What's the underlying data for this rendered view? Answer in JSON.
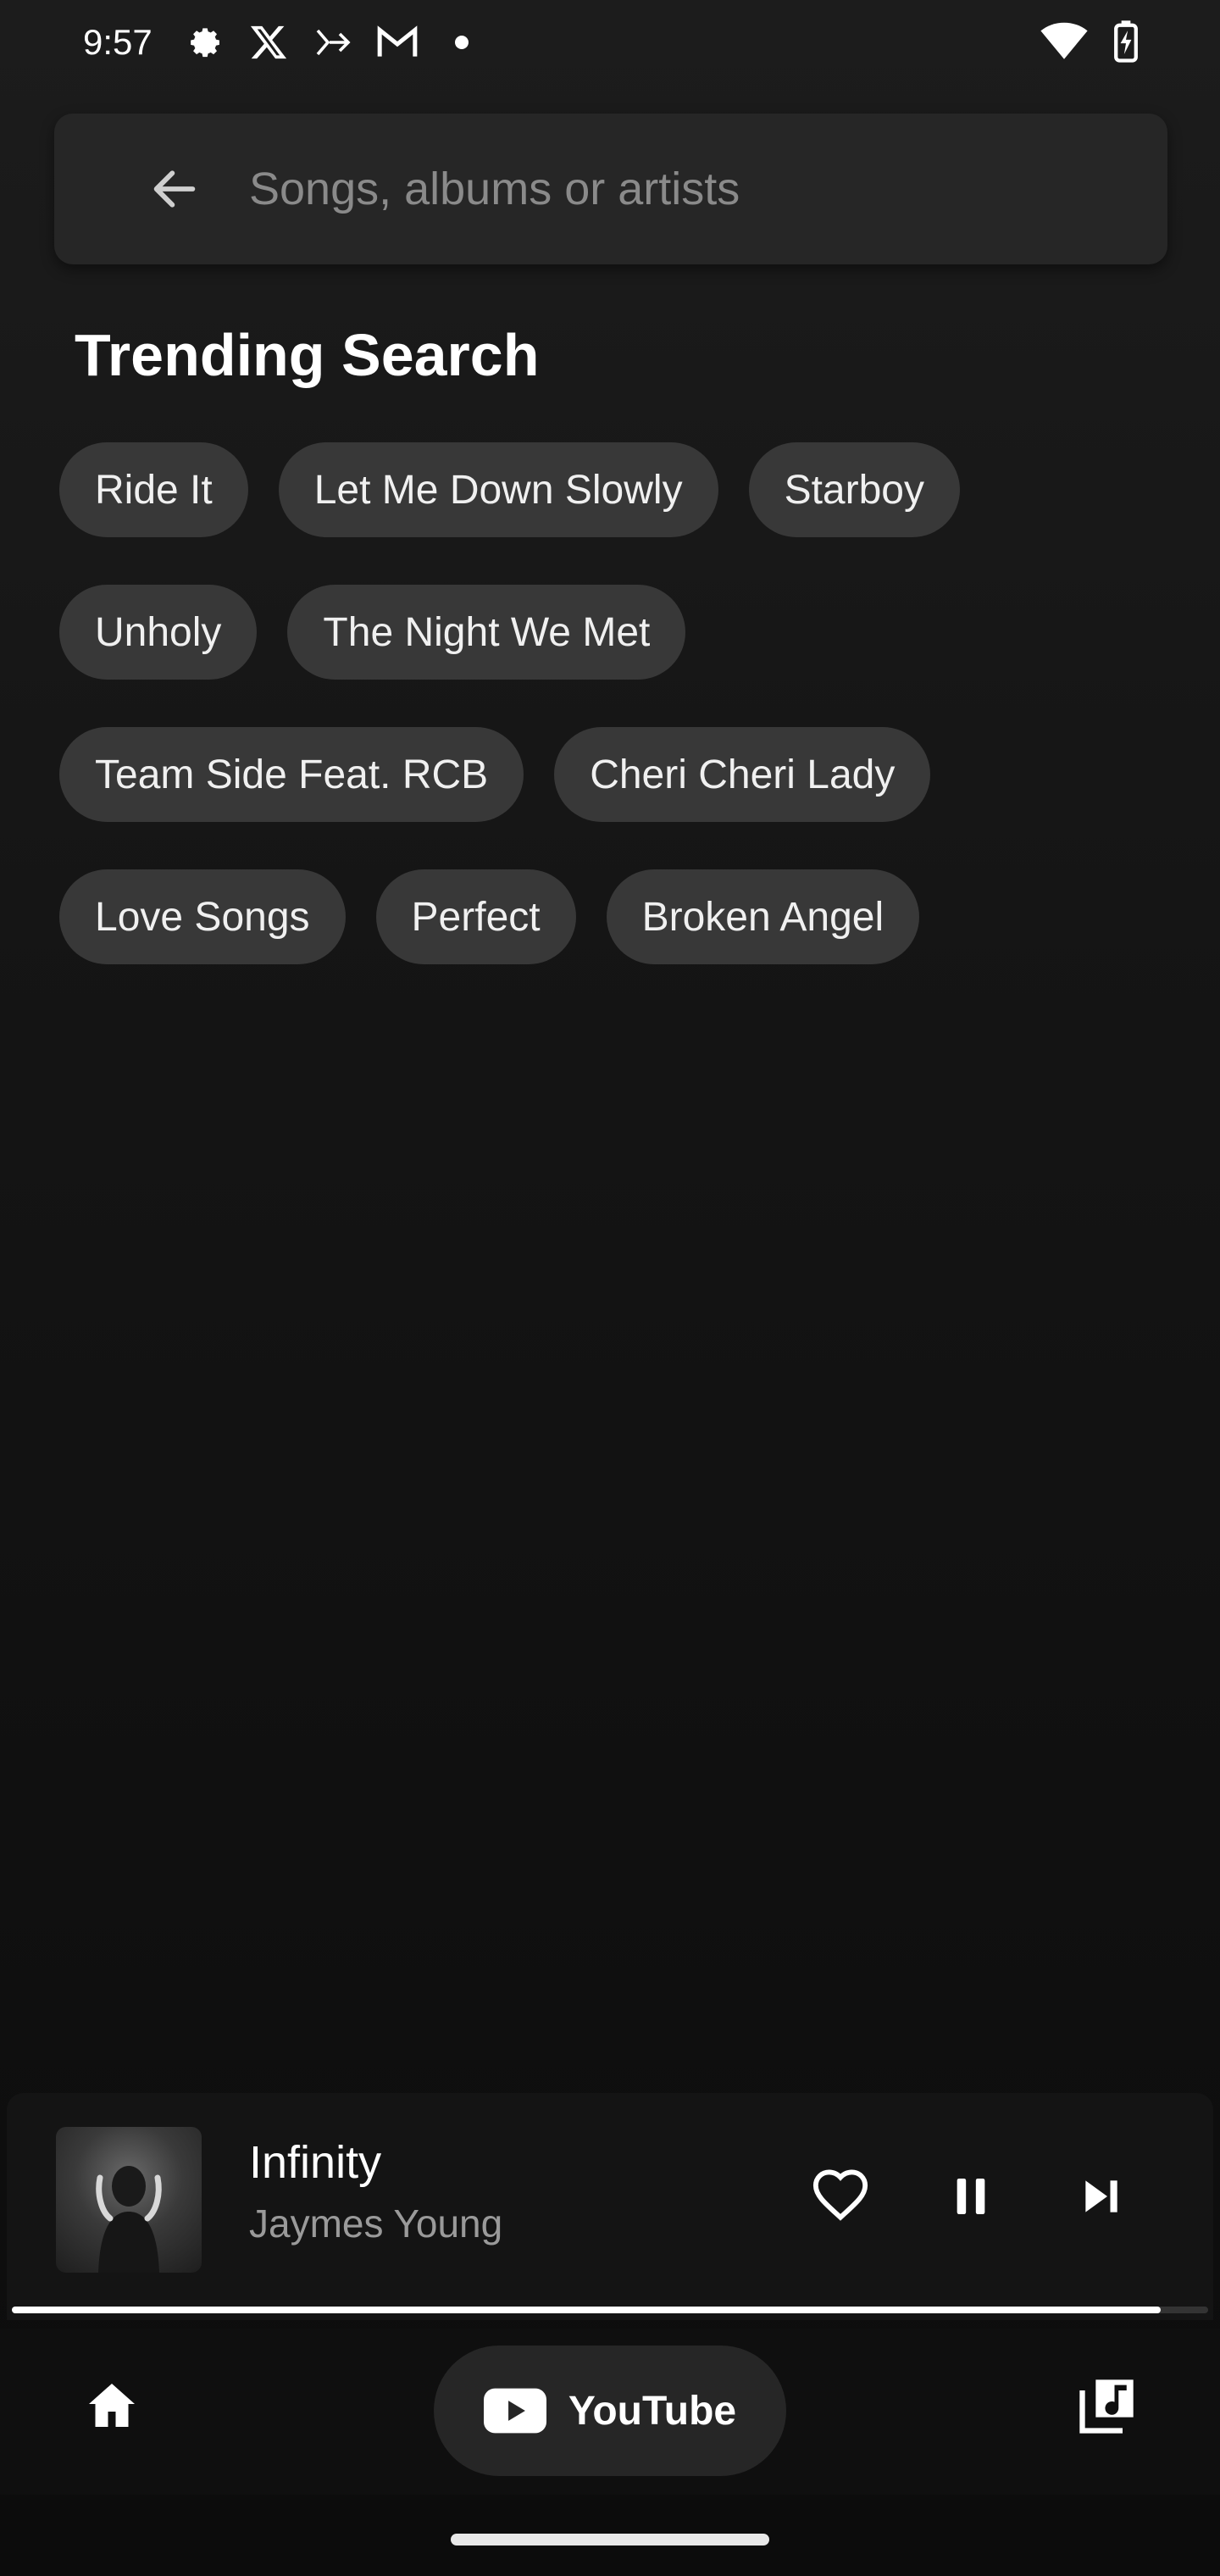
{
  "status_bar": {
    "time": "9:57",
    "left_icons": [
      "settings-gear-icon",
      "x-logo-icon",
      "forward-arrow-icon",
      "mail-icon",
      "dot-icon"
    ],
    "right_icons": [
      "wifi-icon",
      "battery-charging-icon"
    ]
  },
  "search": {
    "placeholder": "Songs, albums or artists",
    "back_icon": "arrow-left-icon"
  },
  "trending": {
    "title": "Trending Search",
    "rows": [
      [
        "Ride It",
        "Let Me Down Slowly",
        "Starboy"
      ],
      [
        "Unholy",
        "The Night We Met"
      ],
      [
        "Team Side Feat. RCB",
        "Cheri Cheri Lady"
      ],
      [
        "Love Songs",
        "Perfect",
        "Broken Angel"
      ]
    ]
  },
  "player": {
    "title": "Infinity",
    "artist": "Jaymes Young",
    "progress": 0.96,
    "icons": [
      "heart-icon",
      "pause-icon",
      "skip-next-icon"
    ]
  },
  "bottom_nav": {
    "home_icon": "home-icon",
    "center_label": "YouTube",
    "library_icon": "music-library-icon"
  }
}
